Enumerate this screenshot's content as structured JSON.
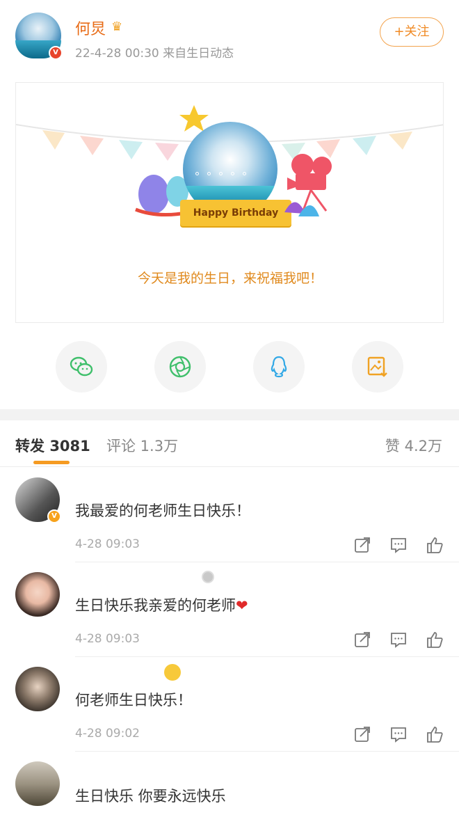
{
  "post": {
    "user_name": "何炅",
    "crown_icon": "crown-icon",
    "meta": "22-4-28 00:30  来自生日动态",
    "follow_label": "+关注",
    "card": {
      "banner_text": "Happy Birthday",
      "caption": "今天是我的生日，来祝福我吧！"
    }
  },
  "share": {
    "icons": [
      "wechat-icon",
      "moments-icon",
      "qq-icon",
      "save-image-icon"
    ]
  },
  "tabs": {
    "repost_label": "转发",
    "repost_count": "3081",
    "comment_label": "评论 1.3万",
    "like_label": "赞 4.2万"
  },
  "comments": [
    {
      "name": "",
      "text": "我最爱的何老师生日快乐！",
      "time": "4-28 09:03"
    },
    {
      "name": "",
      "text": "生日快乐我亲爱的何老师",
      "time": "4-28 09:03",
      "emoji": "❤"
    },
    {
      "name": "",
      "text": "何老师生日快乐！",
      "time": "4-28 09:02"
    },
    {
      "name": "",
      "text": "生日快乐 你要永远快乐",
      "time": ""
    }
  ],
  "colors": {
    "accent": "#f59b22",
    "name_orange": "#e86b16",
    "caption_orange": "#e08a1e"
  }
}
